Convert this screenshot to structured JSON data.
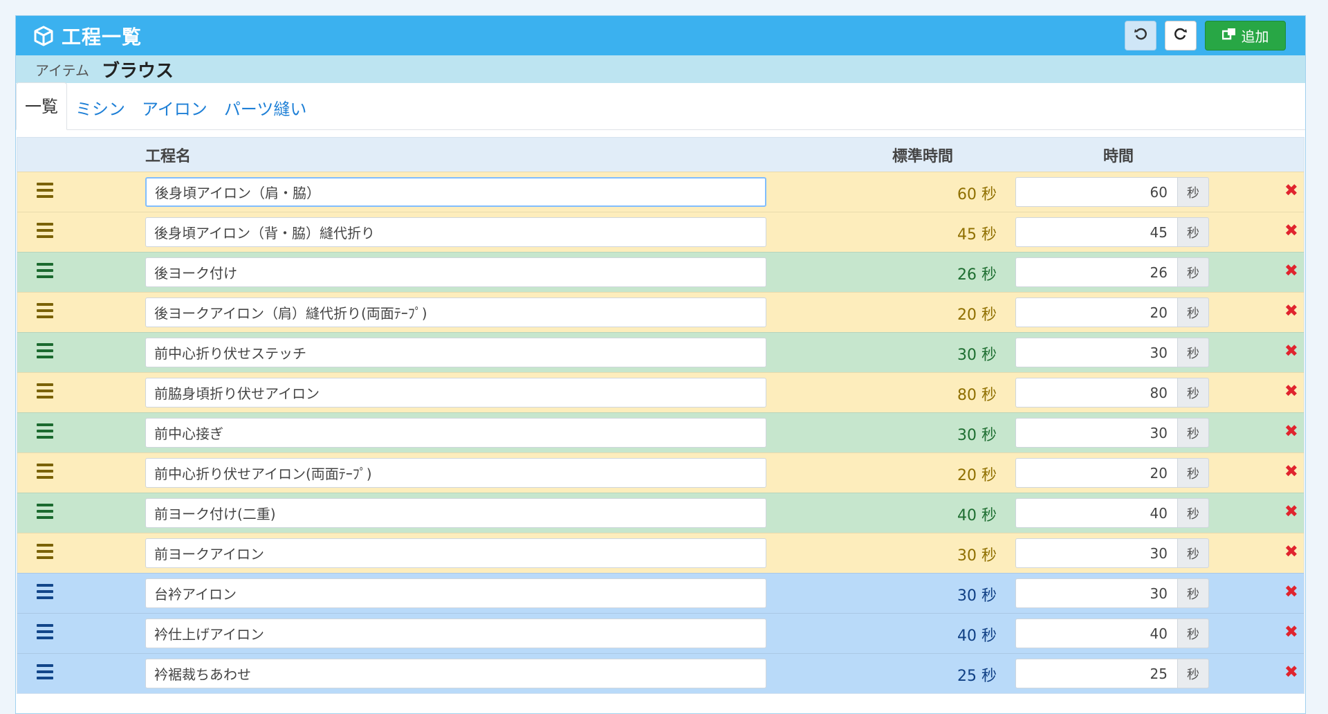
{
  "header": {
    "title": "工程一覧",
    "icon": "cube-icon",
    "undo_icon": "undo-icon",
    "redo_icon": "redo-icon",
    "add_label": "追加"
  },
  "item": {
    "label": "アイテム",
    "value": "ブラウス"
  },
  "tabs": [
    {
      "label": "一覧",
      "active": true
    },
    {
      "label": "ミシン"
    },
    {
      "label": "アイロン"
    },
    {
      "label": "パーツ縫い"
    }
  ],
  "columns": {
    "name": "工程名",
    "standard_time": "標準時間",
    "time": "時間"
  },
  "unit": "秒",
  "rows": [
    {
      "name": "後身頃アイロン（肩・脇）",
      "std": "60 秒",
      "time": "60",
      "color": "yellow"
    },
    {
      "name": "後身頃アイロン（背・脇）縫代折り",
      "std": "45 秒",
      "time": "45",
      "color": "yellow"
    },
    {
      "name": "後ヨーク付け",
      "std": "26 秒",
      "time": "26",
      "color": "green"
    },
    {
      "name": "後ヨークアイロン（肩）縫代折り(両面ﾃｰﾌﾟ)",
      "std": "20 秒",
      "time": "20",
      "color": "yellow"
    },
    {
      "name": "前中心折り伏せステッチ",
      "std": "30 秒",
      "time": "30",
      "color": "green"
    },
    {
      "name": "前脇身頃折り伏せアイロン",
      "std": "80 秒",
      "time": "80",
      "color": "yellow"
    },
    {
      "name": "前中心接ぎ",
      "std": "30 秒",
      "time": "30",
      "color": "green"
    },
    {
      "name": "前中心折り伏せアイロン(両面ﾃｰﾌﾟ)",
      "std": "20 秒",
      "time": "20",
      "color": "yellow"
    },
    {
      "name": "前ヨーク付け(二重)",
      "std": "40 秒",
      "time": "40",
      "color": "green"
    },
    {
      "name": "前ヨークアイロン",
      "std": "30 秒",
      "time": "30",
      "color": "yellow"
    },
    {
      "name": "台衿アイロン",
      "std": "30 秒",
      "time": "30",
      "color": "blue"
    },
    {
      "name": "衿仕上げアイロン",
      "std": "40 秒",
      "time": "40",
      "color": "blue"
    },
    {
      "name": "衿裾裁ちあわせ",
      "std": "25 秒",
      "time": "25",
      "color": "blue"
    }
  ],
  "colors": {
    "titlebar": "#3bb1ef",
    "itembar": "#bde4f1",
    "yellow_row": "#fdedbc",
    "green_row": "#c6e6cd",
    "blue_row": "#b9daf9",
    "add_button": "#28a745",
    "delete": "#e0242e"
  }
}
